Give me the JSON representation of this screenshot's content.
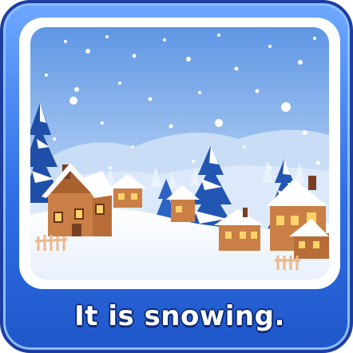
{
  "caption": {
    "text": "It is snowing."
  },
  "colors": {
    "card_border": "#1c3f9f",
    "card_fill": "#2f6fe6",
    "sky_top": "#5b94e3",
    "sky_bottom": "#dbe9fb",
    "snow": "#ffffff",
    "pine_dark": "#1f4fa8",
    "house_wall": "#c97f45",
    "roof_brown": "#8a4b2a",
    "window_glow": "#ffd36a"
  },
  "scene": {
    "icon": "winter-village-scene"
  }
}
